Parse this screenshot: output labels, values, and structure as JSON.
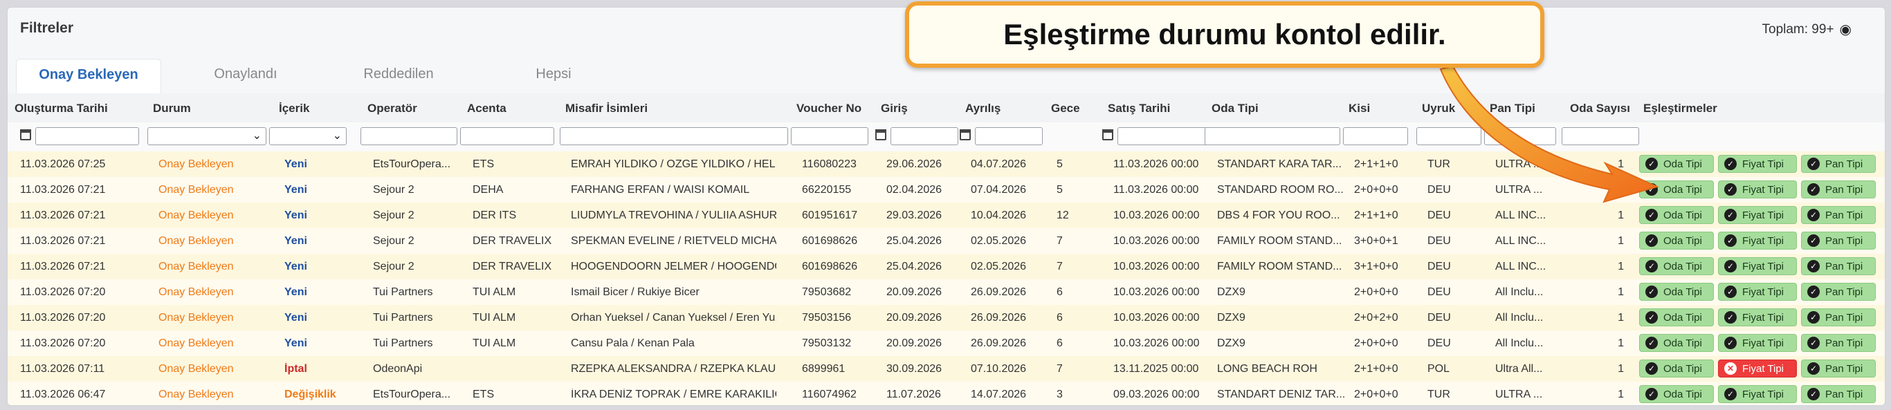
{
  "header": {
    "title": "Filtreler",
    "total_label": "Toplam: 99+",
    "eye_icon": "eye-icon"
  },
  "tabs": [
    {
      "label": "Onay Bekleyen",
      "active": true
    },
    {
      "label": "Onaylandı",
      "active": false
    },
    {
      "label": "Reddedilen",
      "active": false
    },
    {
      "label": "Hepsi",
      "active": false
    }
  ],
  "columns": [
    "Oluşturma Tarihi",
    "Durum",
    "İçerik",
    "Operatör",
    "Acenta",
    "Misafir İsimleri",
    "Voucher No",
    "Giriş",
    "Ayrılış",
    "Gece",
    "Satış Tarihi",
    "Oda Tipi",
    "Kisi",
    "Uyruk",
    "Pan Tipi",
    "Oda Sayısı",
    "Eşleştirmeler"
  ],
  "match_labels": {
    "room": "Oda Tipi",
    "price": "Fiyat Tipi",
    "pan": "Pan Tipi"
  },
  "rows": [
    {
      "created": "11.03.2026 07:25",
      "status": "Onay Bekleyen",
      "content": "Yeni",
      "operator": "EtsTourOpera...",
      "agency": "ETS",
      "guests": "EMRAH YILDIKO / OZGE YILDIKO / HELIN...",
      "voucher": "116080223",
      "checkin": "29.06.2026",
      "checkout": "04.07.2026",
      "nights": "5",
      "sale_date": "11.03.2026 00:00",
      "room_type": "STANDART KARA TAR...",
      "persons": "2+1+1+0",
      "nationality": "TUR",
      "pan_type": "ULTRA ...",
      "room_count": "1",
      "price_ok": true
    },
    {
      "created": "11.03.2026 07:21",
      "status": "Onay Bekleyen",
      "content": "Yeni",
      "operator": "Sejour 2",
      "agency": "DEHA",
      "guests": "FARHANG ERFAN / WAISI KOMAIL",
      "voucher": "66220155",
      "checkin": "02.04.2026",
      "checkout": "07.04.2026",
      "nights": "5",
      "sale_date": "11.03.2026 00:00",
      "room_type": "STANDARD ROOM RO...",
      "persons": "2+0+0+0",
      "nationality": "DEU",
      "pan_type": "ULTRA ...",
      "room_count": "1",
      "price_ok": true
    },
    {
      "created": "11.03.2026 07:21",
      "status": "Onay Bekleyen",
      "content": "Yeni",
      "operator": "Sejour 2",
      "agency": "DER ITS",
      "guests": "LIUDMYLA TREVOHINA / YULIIA ASHUR...",
      "voucher": "601951617",
      "checkin": "29.03.2026",
      "checkout": "10.04.2026",
      "nights": "12",
      "sale_date": "10.03.2026 00:00",
      "room_type": "DBS 4 FOR YOU ROO...",
      "persons": "2+1+1+0",
      "nationality": "DEU",
      "pan_type": "ALL INC...",
      "room_count": "1",
      "price_ok": true
    },
    {
      "created": "11.03.2026 07:21",
      "status": "Onay Bekleyen",
      "content": "Yeni",
      "operator": "Sejour 2",
      "agency": "DER TRAVELIX",
      "guests": "SPEKMAN EVELINE / RIETVELD MICHAEL...",
      "voucher": "601698626",
      "checkin": "25.04.2026",
      "checkout": "02.05.2026",
      "nights": "7",
      "sale_date": "10.03.2026 00:00",
      "room_type": "FAMILY ROOM STAND...",
      "persons": "3+0+0+1",
      "nationality": "DEU",
      "pan_type": "ALL INC...",
      "room_count": "1",
      "price_ok": true
    },
    {
      "created": "11.03.2026 07:21",
      "status": "Onay Bekleyen",
      "content": "Yeni",
      "operator": "Sejour 2",
      "agency": "DER TRAVELIX",
      "guests": "HOOGENDOORN JELMER / HOOGENDO...",
      "voucher": "601698626",
      "checkin": "25.04.2026",
      "checkout": "02.05.2026",
      "nights": "7",
      "sale_date": "10.03.2026 00:00",
      "room_type": "FAMILY ROOM STAND...",
      "persons": "3+1+0+0",
      "nationality": "DEU",
      "pan_type": "ALL INC...",
      "room_count": "1",
      "price_ok": true
    },
    {
      "created": "11.03.2026 07:20",
      "status": "Onay Bekleyen",
      "content": "Yeni",
      "operator": "Tui Partners",
      "agency": "TUI ALM",
      "guests": "Ismail Bicer / Rukiye Bicer",
      "voucher": "79503682",
      "checkin": "20.09.2026",
      "checkout": "26.09.2026",
      "nights": "6",
      "sale_date": "10.03.2026 00:00",
      "room_type": "DZX9",
      "persons": "2+0+0+0",
      "nationality": "DEU",
      "pan_type": "All Inclu...",
      "room_count": "1",
      "price_ok": true
    },
    {
      "created": "11.03.2026 07:20",
      "status": "Onay Bekleyen",
      "content": "Yeni",
      "operator": "Tui Partners",
      "agency": "TUI ALM",
      "guests": "Orhan Yueksel / Canan Yueksel / Eren Yu...",
      "voucher": "79503156",
      "checkin": "20.09.2026",
      "checkout": "26.09.2026",
      "nights": "6",
      "sale_date": "10.03.2026 00:00",
      "room_type": "DZX9",
      "persons": "2+0+2+0",
      "nationality": "DEU",
      "pan_type": "All Inclu...",
      "room_count": "1",
      "price_ok": true
    },
    {
      "created": "11.03.2026 07:20",
      "status": "Onay Bekleyen",
      "content": "Yeni",
      "operator": "Tui Partners",
      "agency": "TUI ALM",
      "guests": "Cansu Pala / Kenan Pala",
      "voucher": "79503132",
      "checkin": "20.09.2026",
      "checkout": "26.09.2026",
      "nights": "6",
      "sale_date": "10.03.2026 00:00",
      "room_type": "DZX9",
      "persons": "2+0+0+0",
      "nationality": "DEU",
      "pan_type": "All Inclu...",
      "room_count": "1",
      "price_ok": true
    },
    {
      "created": "11.03.2026 07:11",
      "status": "Onay Bekleyen",
      "content": "İptal",
      "operator": "OdeonApi",
      "agency": "",
      "guests": "RZEPKA ALEKSANDRA / RZEPKA KLAUDI...",
      "voucher": "6899961",
      "checkin": "30.09.2026",
      "checkout": "07.10.2026",
      "nights": "7",
      "sale_date": "13.11.2025 00:00",
      "room_type": "LONG BEACH ROH",
      "persons": "2+1+0+0",
      "nationality": "POL",
      "pan_type": "Ultra All...",
      "room_count": "1",
      "price_ok": false
    },
    {
      "created": "11.03.2026 06:47",
      "status": "Onay Bekleyen",
      "content": "Değişiklik",
      "operator": "EtsTourOpera...",
      "agency": "ETS",
      "guests": "İKRA DENİZ TOPRAK / EMRE KARAKILIÇ",
      "voucher": "116074962",
      "checkin": "11.07.2026",
      "checkout": "14.07.2026",
      "nights": "3",
      "sale_date": "09.03.2026 00:00",
      "room_type": "STANDART DENIZ TAR...",
      "persons": "2+0+0+0",
      "nationality": "TUR",
      "pan_type": "ULTRA ...",
      "room_count": "1",
      "price_ok": true
    }
  ],
  "callout": {
    "text": "Eşleştirme durumu kontol edilir."
  },
  "colors": {
    "status": "#f07b18",
    "content_new": "#1f4fa0",
    "content_cancel": "#c92a2a",
    "match_ok": "#a6dd9c",
    "match_error": "#ee3b3b",
    "callout_border": "#f2a232"
  }
}
